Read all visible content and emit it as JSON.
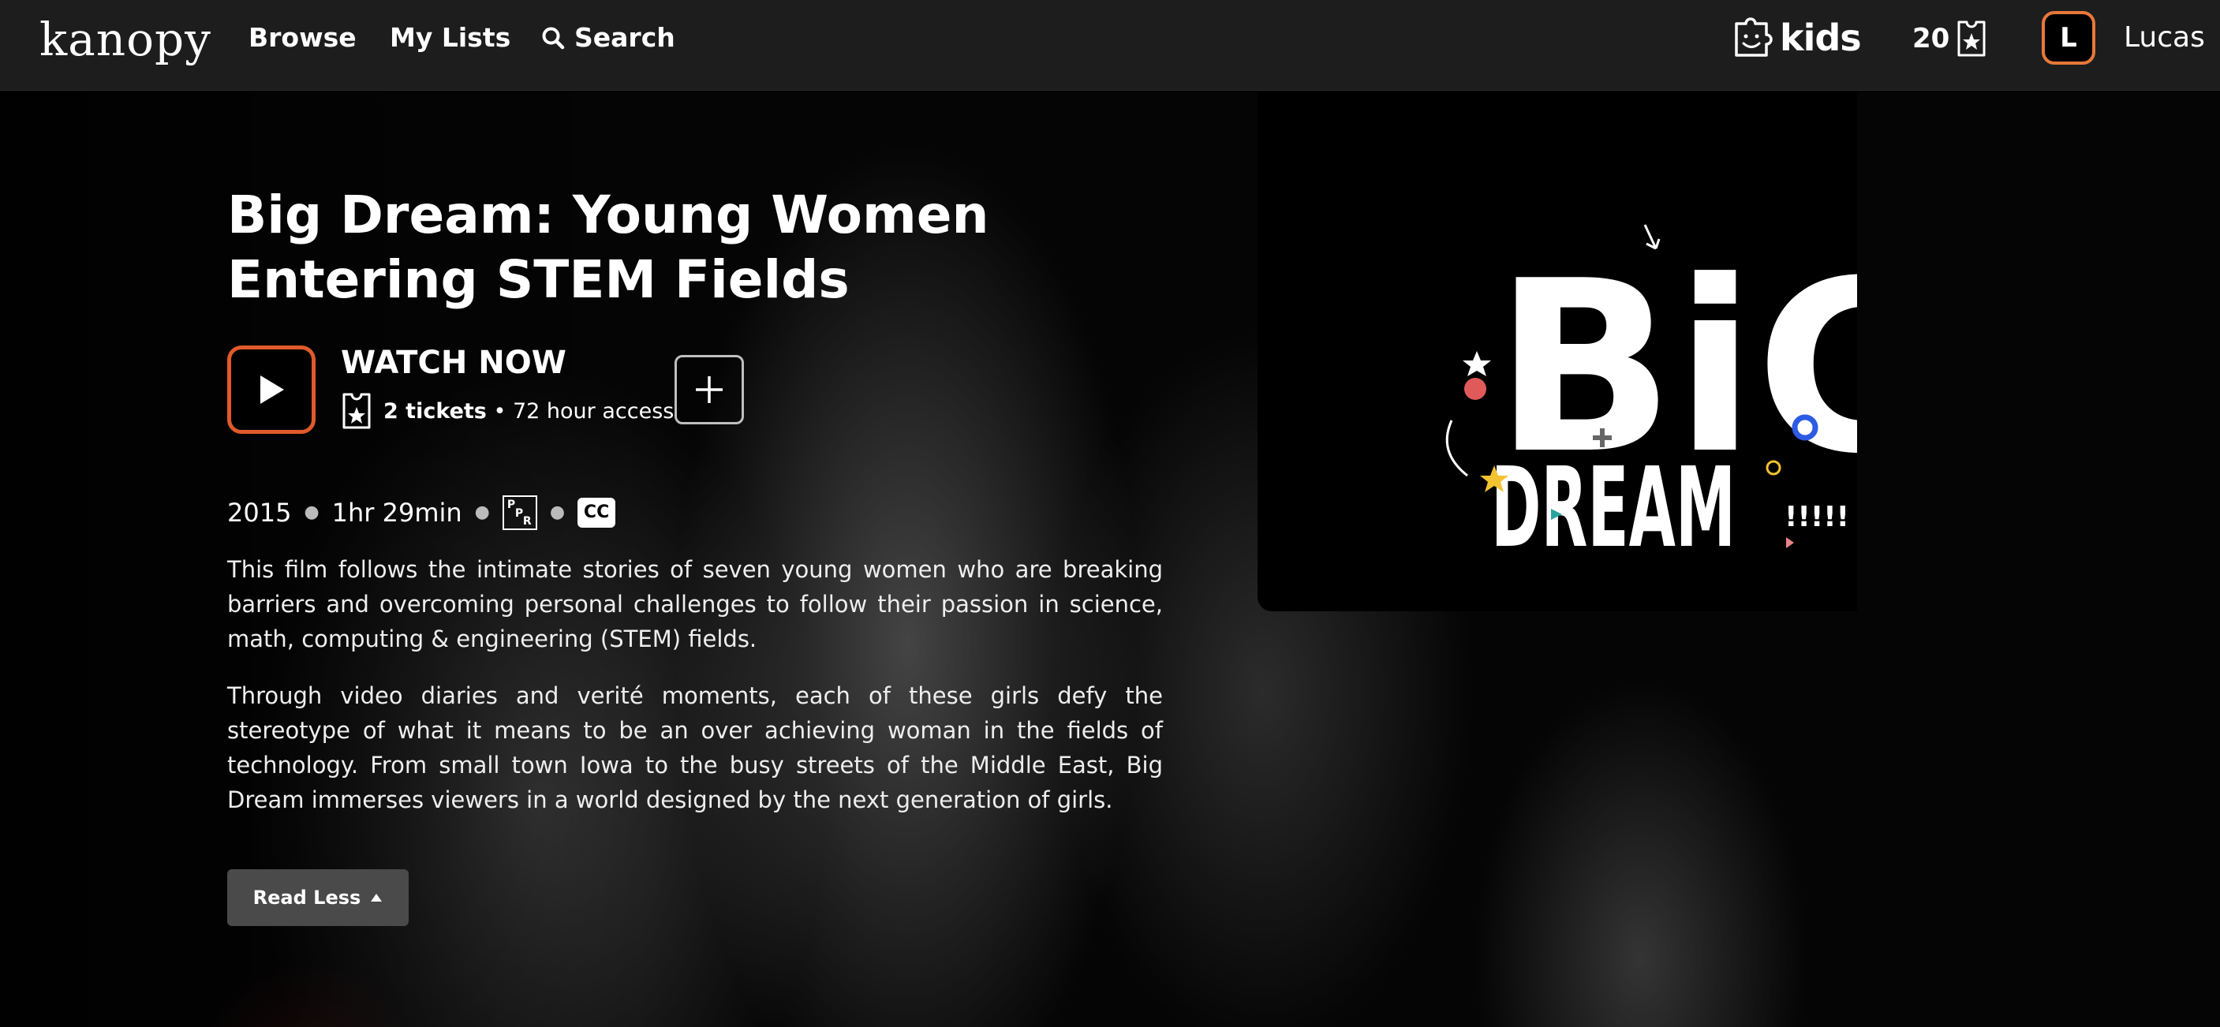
{
  "header": {
    "logo": "kanopy",
    "nav": {
      "browse": "Browse",
      "my_lists": "My Lists",
      "search": "Search"
    },
    "kids_label": "kids",
    "ticket_count": "20",
    "avatar_initial": "L",
    "username": "Lucas"
  },
  "film": {
    "title": "Big Dream: Young Women Entering STEM Fields",
    "watch_label": "WATCH NOW",
    "tickets": "2 tickets",
    "access": "• 72 hour access",
    "year": "2015",
    "duration": "1hr 29min",
    "rating_letters": {
      "top": "P",
      "mid": "P",
      "bottom": "R"
    },
    "cc_label": "CC",
    "description_1": "This film follows the intimate stories of seven young women who are breaking barriers and overcoming personal challenges to follow their passion in science, math, computing & engineering (STEM) fields.",
    "description_2": "Through video diaries and verité moments, each of these girls defy the stereotype of what it means to be an over achieving woman in the fields of technology. From small town Iowa to the busy streets of the Middle East, Big Dream immerses viewers in a world designed by the next generation of girls.",
    "read_less_label": "Read Less"
  },
  "poster": {
    "line1": "BiG",
    "line2": "DREAM",
    "exclaim": "!!!!!"
  },
  "colors": {
    "accent": "#e05a2b",
    "avatar_border": "#e8783a",
    "topbar": "#1d1d1d",
    "button_gray": "#4a4a4a"
  },
  "icons": [
    "search-icon",
    "kids-puzzle-icon",
    "ticket-icon",
    "play-icon",
    "plus-icon",
    "caret-up-icon"
  ]
}
